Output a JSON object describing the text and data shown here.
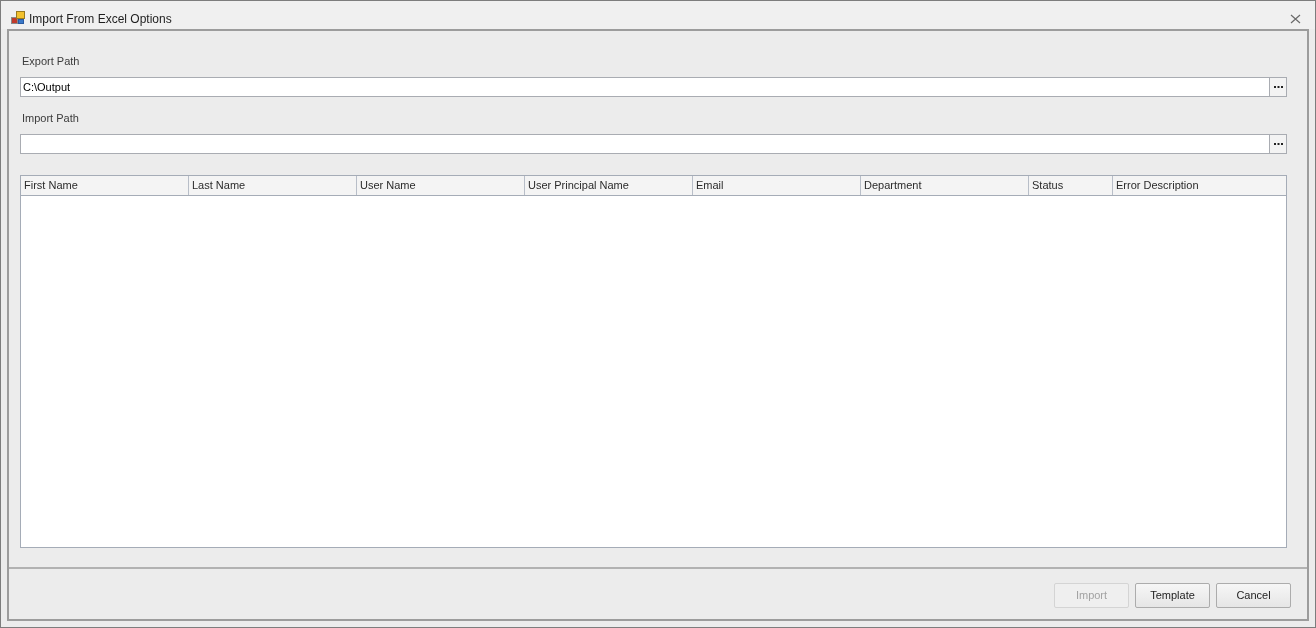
{
  "window": {
    "title": "Import From Excel Options"
  },
  "fields": [
    {
      "label": "Export Path",
      "value": "C:\\Output"
    },
    {
      "label": "Import Path"
    }
  ],
  "table": {
    "columns": [
      "First Name",
      "Last Name",
      "User Name",
      "User Principal Name",
      "Email",
      "Department",
      "Status",
      "Error Description"
    ]
  },
  "buttons": [
    {
      "label": "Import",
      "disabled": true
    },
    {
      "label": "Template",
      "disabled": false
    },
    {
      "label": "Cancel",
      "disabled": false
    }
  ]
}
